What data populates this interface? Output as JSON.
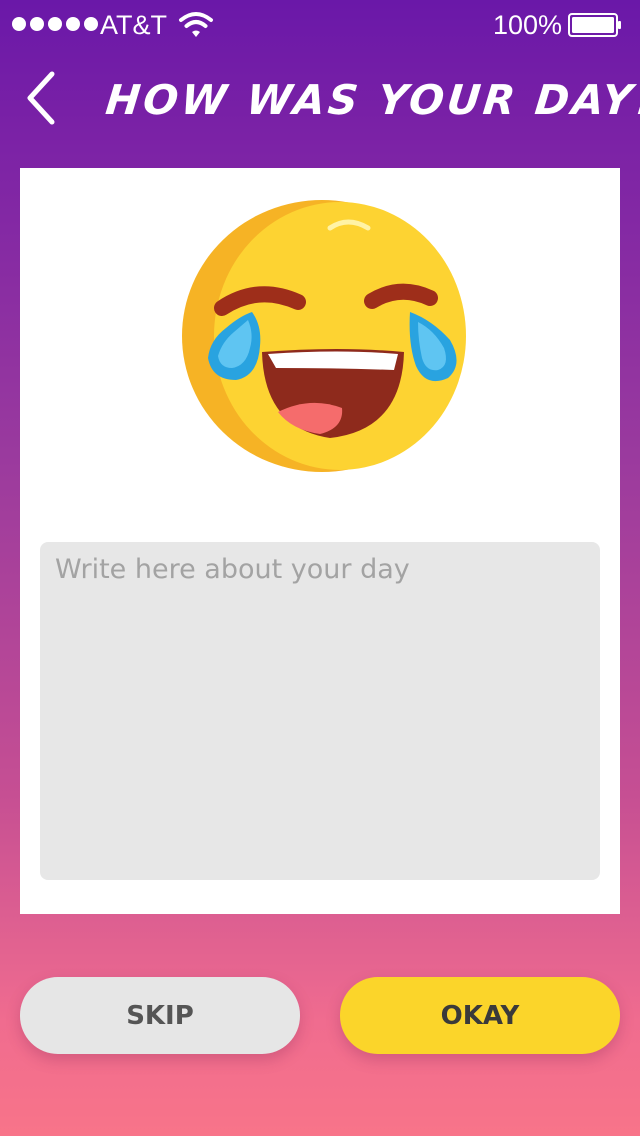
{
  "status_bar": {
    "carrier": "AT&T",
    "signal_bars": 5,
    "battery_percent": "100%"
  },
  "header": {
    "title": "HOW WAS YOUR DAY?"
  },
  "mood": {
    "emoji_icon": "laughing-with-tears-emoji-icon"
  },
  "note": {
    "placeholder": "Write here about your day",
    "value": ""
  },
  "actions": {
    "skip_label": "SKIP",
    "okay_label": "OKAY"
  },
  "colors": {
    "gradient_top": "#6A18A8",
    "gradient_bottom": "#F87489",
    "okay_button": "#FBD52A",
    "skip_button": "#E6E6E6",
    "field_background": "#E7E7E7"
  }
}
